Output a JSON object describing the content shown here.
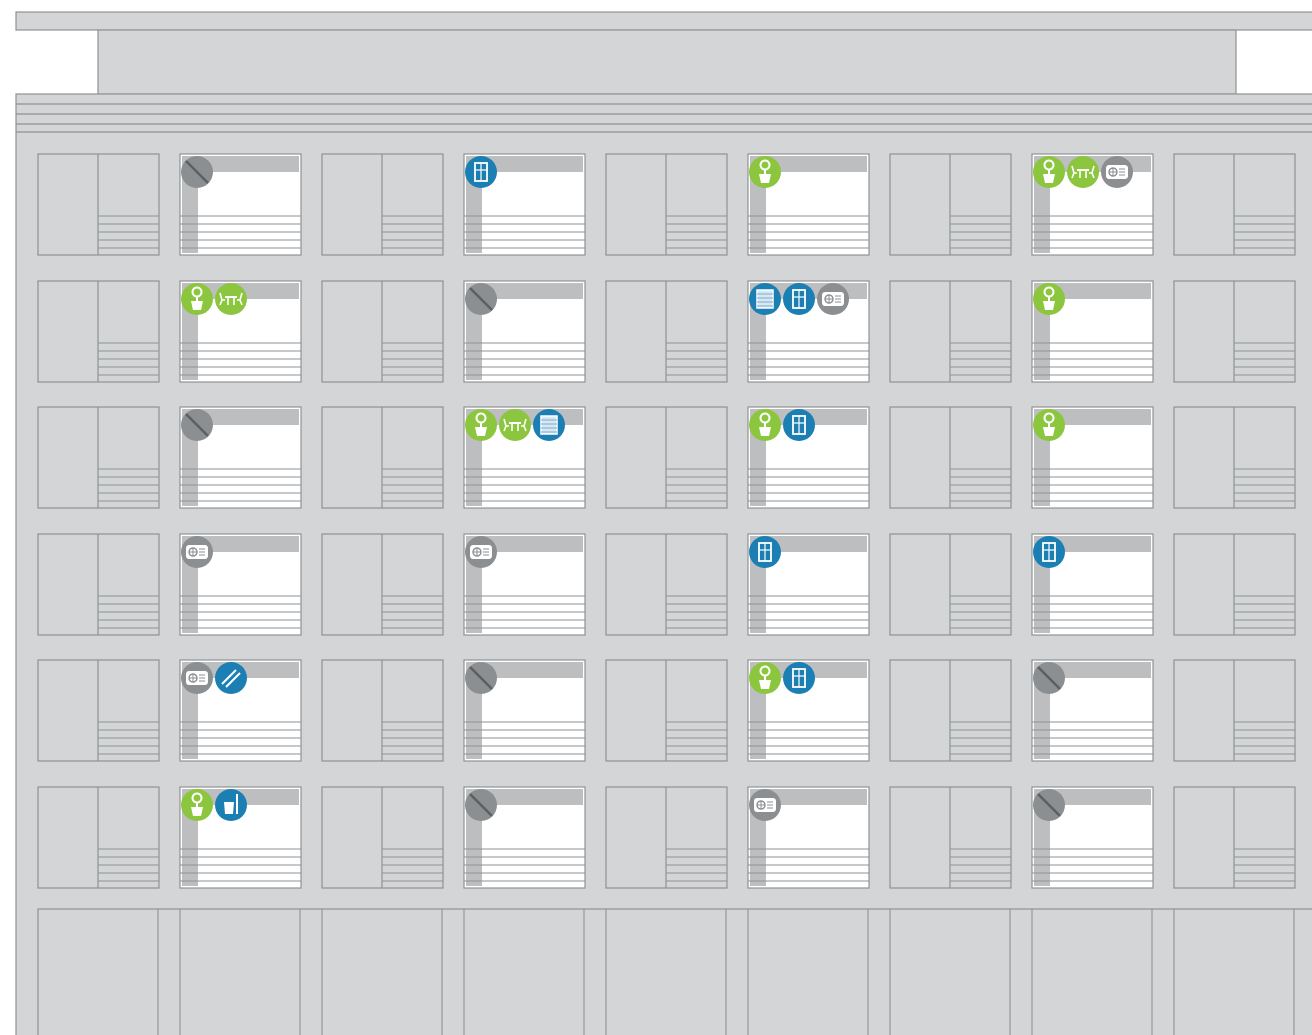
{
  "colors": {
    "facade": "#d3d5d6",
    "line": "#8f9294",
    "window": "#ffffff",
    "shade": "#bcbec0",
    "green": "#8cc63e",
    "blue": "#1b7fb4",
    "gray": "#8c8f91"
  },
  "legend_icon_types": {
    "plant": "green",
    "table": "green",
    "door": "blue",
    "blind": "blue",
    "broom": "blue",
    "cleaning": "blue",
    "socket": "gray",
    "none": "gray"
  },
  "facade": {
    "floors": 6,
    "bays": 9,
    "windows": [
      {
        "floor": 1,
        "bay": 2,
        "icons": [
          "none"
        ]
      },
      {
        "floor": 1,
        "bay": 4,
        "icons": [
          "door"
        ]
      },
      {
        "floor": 1,
        "bay": 6,
        "icons": [
          "plant"
        ]
      },
      {
        "floor": 1,
        "bay": 8,
        "icons": [
          "plant",
          "table",
          "socket"
        ]
      },
      {
        "floor": 2,
        "bay": 2,
        "icons": [
          "plant",
          "table"
        ]
      },
      {
        "floor": 2,
        "bay": 4,
        "icons": [
          "none"
        ]
      },
      {
        "floor": 2,
        "bay": 6,
        "icons": [
          "blind",
          "door",
          "socket"
        ]
      },
      {
        "floor": 2,
        "bay": 8,
        "icons": [
          "plant"
        ]
      },
      {
        "floor": 3,
        "bay": 2,
        "icons": [
          "none"
        ]
      },
      {
        "floor": 3,
        "bay": 4,
        "icons": [
          "plant",
          "table",
          "blind"
        ]
      },
      {
        "floor": 3,
        "bay": 6,
        "icons": [
          "plant",
          "door"
        ]
      },
      {
        "floor": 3,
        "bay": 8,
        "icons": [
          "plant"
        ]
      },
      {
        "floor": 4,
        "bay": 2,
        "icons": [
          "socket"
        ]
      },
      {
        "floor": 4,
        "bay": 4,
        "icons": [
          "socket"
        ]
      },
      {
        "floor": 4,
        "bay": 6,
        "icons": [
          "door"
        ]
      },
      {
        "floor": 4,
        "bay": 8,
        "icons": [
          "door"
        ]
      },
      {
        "floor": 5,
        "bay": 2,
        "icons": [
          "socket",
          "cleaning"
        ]
      },
      {
        "floor": 5,
        "bay": 4,
        "icons": [
          "none"
        ]
      },
      {
        "floor": 5,
        "bay": 6,
        "icons": [
          "plant",
          "door"
        ]
      },
      {
        "floor": 5,
        "bay": 8,
        "icons": [
          "none"
        ]
      },
      {
        "floor": 6,
        "bay": 2,
        "icons": [
          "plant",
          "broom"
        ]
      },
      {
        "floor": 6,
        "bay": 4,
        "icons": [
          "none"
        ]
      },
      {
        "floor": 6,
        "bay": 6,
        "icons": [
          "socket"
        ]
      },
      {
        "floor": 6,
        "bay": 8,
        "icons": [
          "none"
        ]
      }
    ]
  }
}
